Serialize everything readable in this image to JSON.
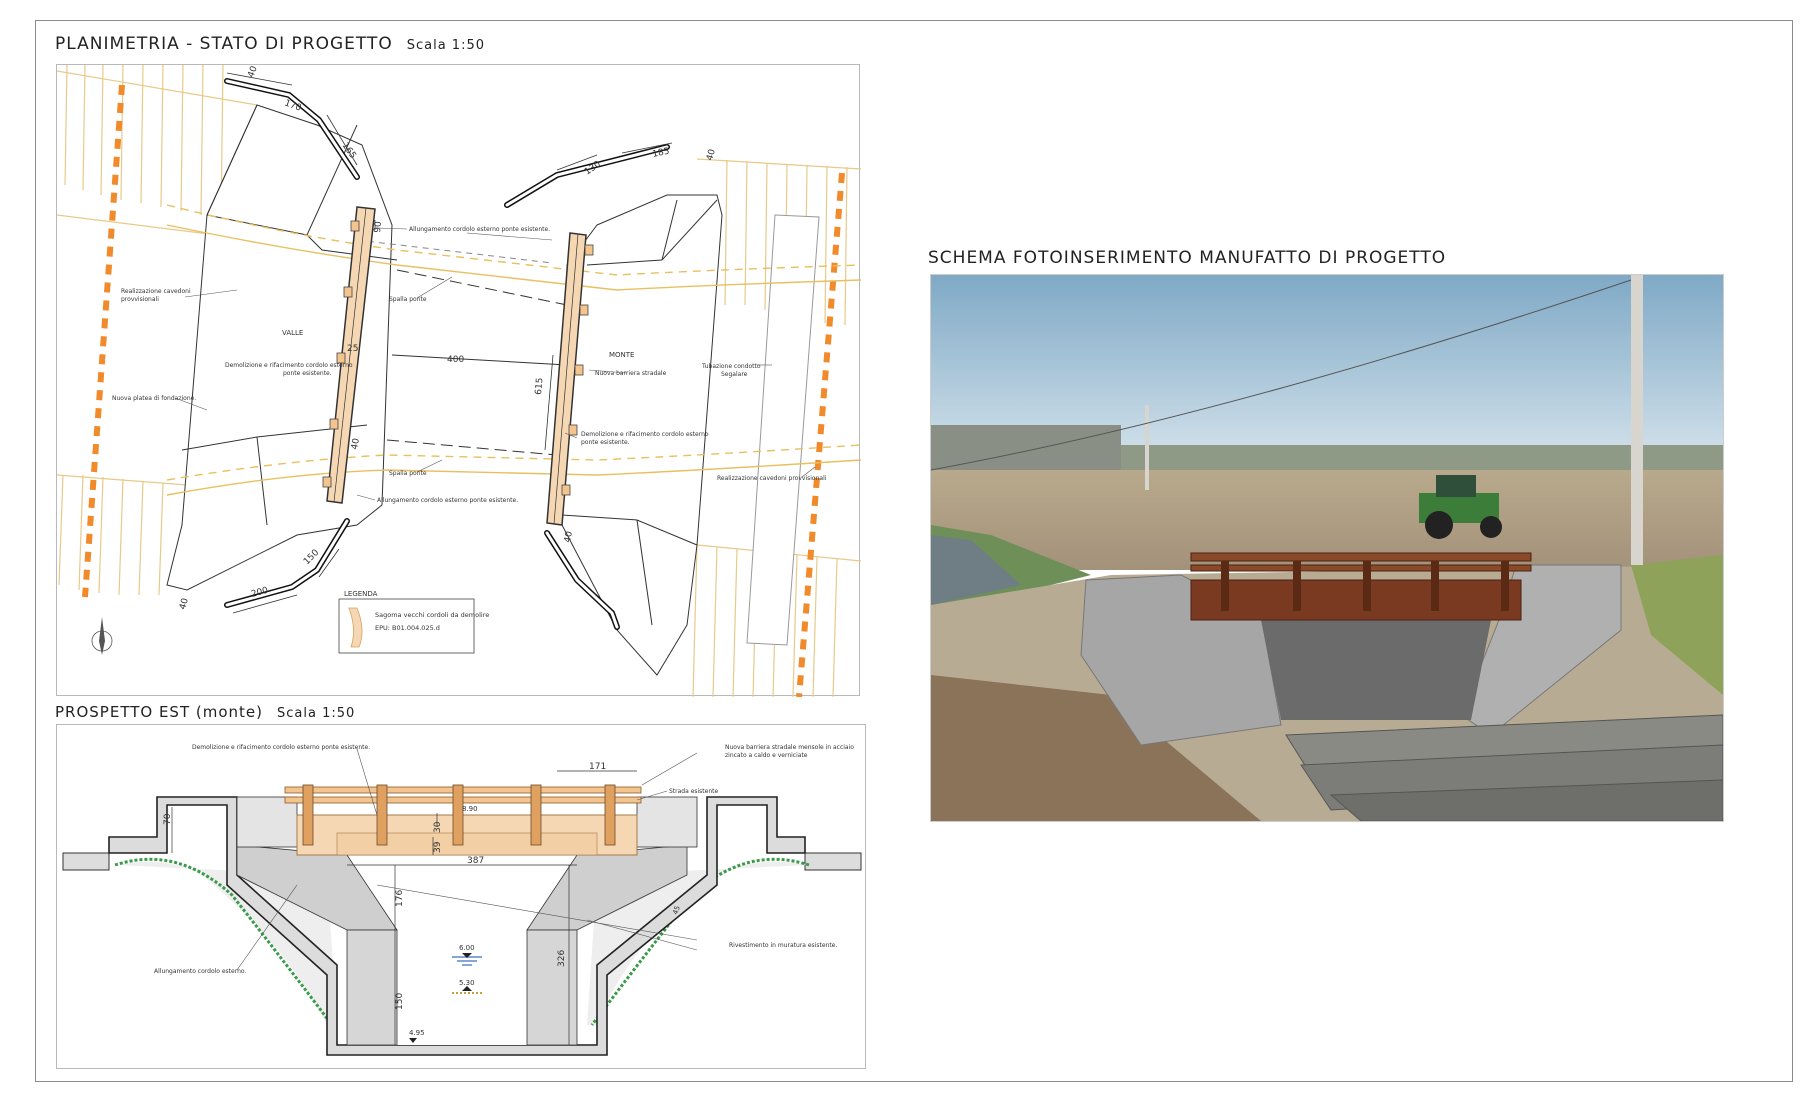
{
  "plan": {
    "title": "PLANIMETRIA - STATO DI PROGETTO",
    "scale": "Scala 1:50",
    "labels": {
      "valle": "VALLE",
      "monte": "MONTE",
      "cavedoni_left_1": "Realizzazione cavedoni",
      "cavedoni_left_2": "provvisionali",
      "platea": "Nuova platea di fondazione.",
      "demol_left_1": "Demolizione e rifacimento cordolo esterno",
      "demol_left_2": "ponte esistente.",
      "allung_top": "Allungamento cordolo esterno ponte esistente.",
      "spalla_top": "Spalla ponte",
      "spalla_bottom": "Spalla ponte",
      "allung_bottom": "Allungamento cordolo esterno ponte esistente.",
      "barriera": "Nuova barriera stradale",
      "demol_right_1": "Demolizione e rifacimento cordolo esterno",
      "demol_right_2": "ponte esistente.",
      "tubazione_1": "Tubazione condotto",
      "tubazione_2": "Segalare",
      "cavedoni_right": "Realizzazione cavedoni provvisionali"
    },
    "dims": {
      "d170": "170",
      "d165": "165",
      "d40a": "40",
      "d90": "90",
      "d400": "400",
      "d25": "25",
      "d40b": "40",
      "d150": "150",
      "d200": "200",
      "d40c": "40",
      "d130": "130",
      "d185": "185",
      "d40d": "40",
      "d615": "615",
      "d40e": "40"
    },
    "legend": {
      "title": "LEGENDA",
      "item": "Sagoma vecchi cordoli da demolire",
      "code": "EPU: B01.004.025.d"
    }
  },
  "elevation": {
    "title": "PROSPETTO EST (monte)",
    "scale": "Scala 1:50",
    "labels": {
      "demol": "Demolizione e rifacimento cordolo esterno ponte esistente.",
      "barriera_1": "Nuova barriera stradale mensole in acciaio",
      "barriera_2": "zincato a caldo e verniciate",
      "strada": "Strada esistente",
      "allung": "Allungamento cordolo esterno.",
      "rivestimento": "Rivestimento in muratura esistente."
    },
    "dims": {
      "d171": "171",
      "d70": "70",
      "d890": "8.90",
      "d39": "39",
      "d30": "30",
      "d387": "387",
      "d176": "176",
      "d326": "326",
      "d45": "45",
      "d150": "150",
      "d600": "6.00",
      "d530": "5.30",
      "d495": "4.95"
    }
  },
  "photo": {
    "title": "SCHEMA FOTOINSERIMENTO MANUFATTO DI PROGETTO"
  }
}
